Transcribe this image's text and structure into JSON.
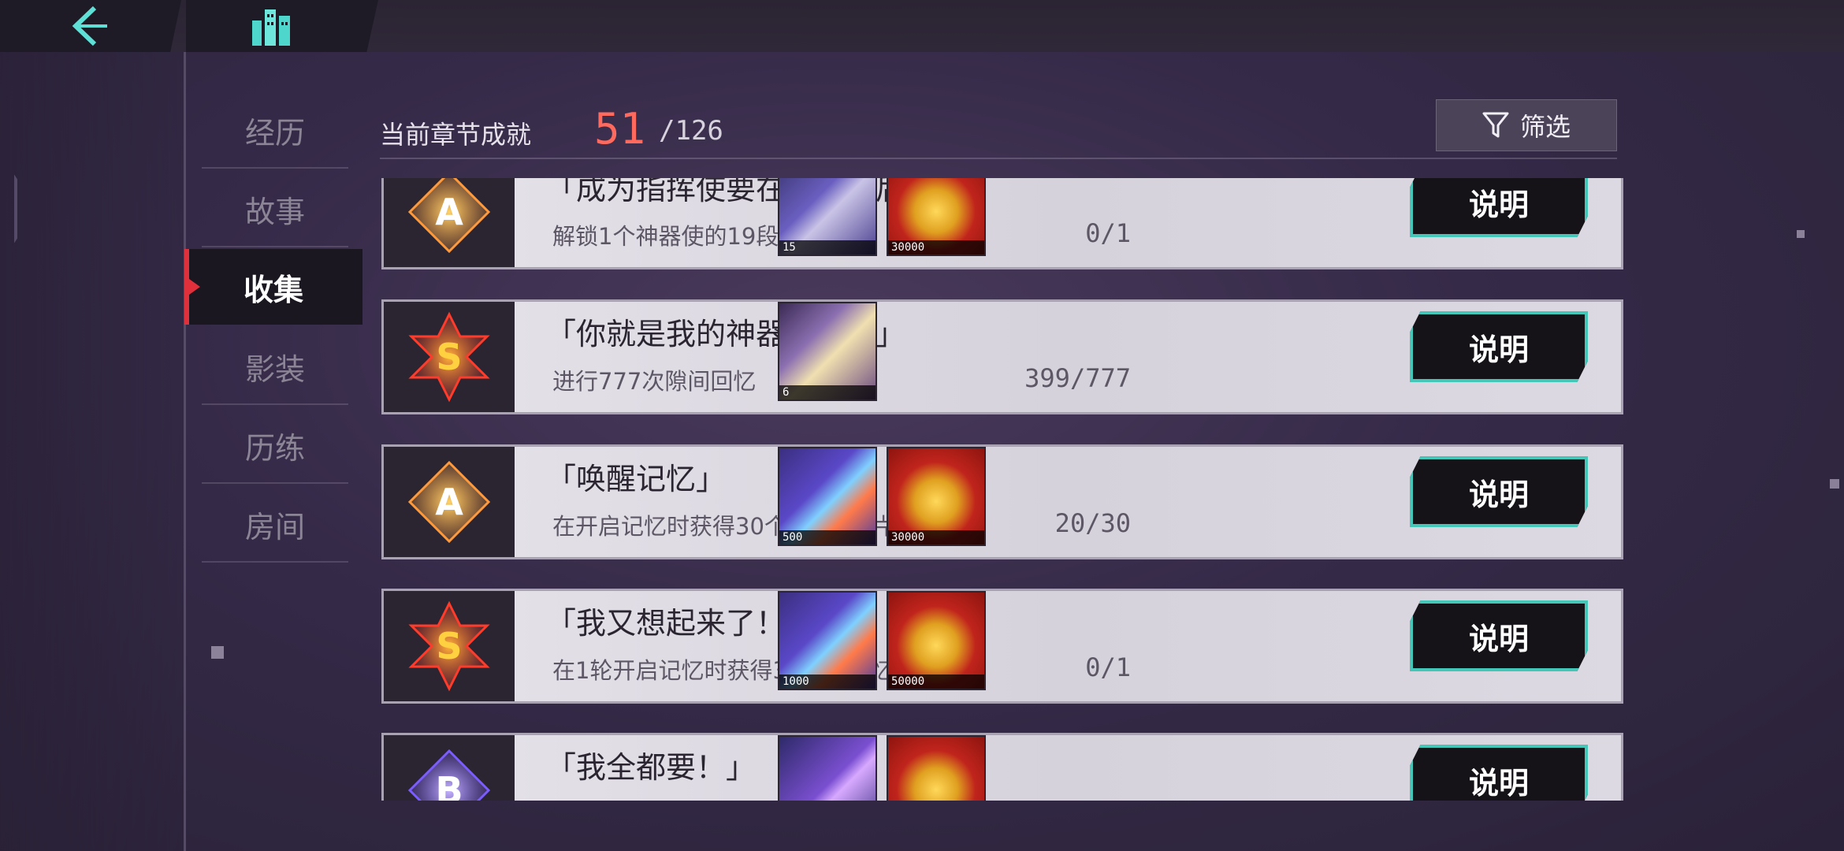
{
  "nav": {
    "items": [
      {
        "label": "经历",
        "active": false
      },
      {
        "label": "故事",
        "active": false
      },
      {
        "label": "收集",
        "active": true
      },
      {
        "label": "影装",
        "active": false
      },
      {
        "label": "历练",
        "active": false
      },
      {
        "label": "房间",
        "active": false
      }
    ]
  },
  "header": {
    "label": "当前章节成就",
    "current": "51",
    "total": "/126"
  },
  "filter": {
    "label": "筛选",
    "icon": "filter-icon"
  },
  "achievements": [
    {
      "rank": "A",
      "title": "「成为指挥使要在了解之后」",
      "desc": "解锁1个神器使的19段档案",
      "progress": "0/1",
      "rewards": [
        {
          "type": "crystal",
          "qty": "15"
        },
        {
          "type": "coins",
          "qty": "30000"
        }
      ],
      "button": "说明"
    },
    {
      "rank": "S",
      "title": "「你就是我的神器使吗？」",
      "desc": "进行777次隙间回忆",
      "progress": "399/777",
      "rewards": [
        {
          "type": "memory-ticket",
          "qty": "6"
        }
      ],
      "button": "说明"
    },
    {
      "rank": "A",
      "title": "「唤醒记忆」",
      "desc": "在开启记忆时获得30个S级记忆片段",
      "progress": "20/30",
      "rewards": [
        {
          "type": "fragment",
          "qty": "500"
        },
        {
          "type": "coins",
          "qty": "30000"
        }
      ],
      "button": "说明"
    },
    {
      "rank": "S",
      "title": "「我又想起来了！」",
      "desc": "在1轮开启记忆时获得3个S级记忆片段",
      "progress": "0/1",
      "rewards": [
        {
          "type": "fragment",
          "qty": "1000"
        },
        {
          "type": "coins",
          "qty": "50000"
        }
      ],
      "button": "说明"
    },
    {
      "rank": "B",
      "title": "「我全都要！」",
      "desc": "",
      "progress": "",
      "rewards": [
        {
          "type": "crystal-purple",
          "qty": ""
        },
        {
          "type": "coins",
          "qty": ""
        }
      ],
      "button": "说明"
    }
  ]
}
